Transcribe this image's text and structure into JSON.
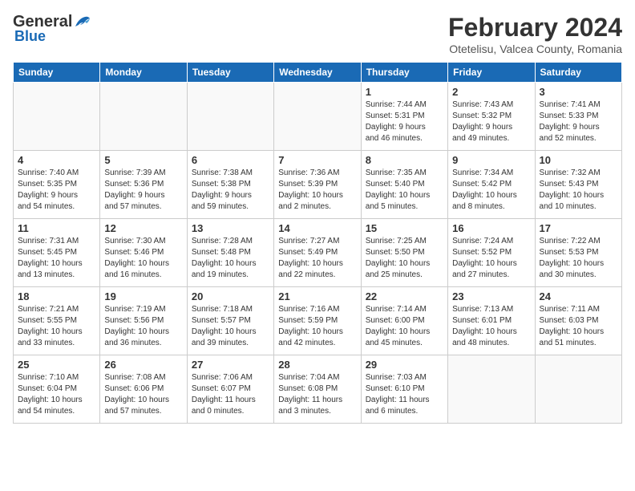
{
  "logo": {
    "general": "General",
    "blue": "Blue"
  },
  "title": {
    "month": "February 2024",
    "location": "Otetelisu, Valcea County, Romania"
  },
  "headers": [
    "Sunday",
    "Monday",
    "Tuesday",
    "Wednesday",
    "Thursday",
    "Friday",
    "Saturday"
  ],
  "weeks": [
    [
      {
        "day": "",
        "info": ""
      },
      {
        "day": "",
        "info": ""
      },
      {
        "day": "",
        "info": ""
      },
      {
        "day": "",
        "info": ""
      },
      {
        "day": "1",
        "info": "Sunrise: 7:44 AM\nSunset: 5:31 PM\nDaylight: 9 hours\nand 46 minutes."
      },
      {
        "day": "2",
        "info": "Sunrise: 7:43 AM\nSunset: 5:32 PM\nDaylight: 9 hours\nand 49 minutes."
      },
      {
        "day": "3",
        "info": "Sunrise: 7:41 AM\nSunset: 5:33 PM\nDaylight: 9 hours\nand 52 minutes."
      }
    ],
    [
      {
        "day": "4",
        "info": "Sunrise: 7:40 AM\nSunset: 5:35 PM\nDaylight: 9 hours\nand 54 minutes."
      },
      {
        "day": "5",
        "info": "Sunrise: 7:39 AM\nSunset: 5:36 PM\nDaylight: 9 hours\nand 57 minutes."
      },
      {
        "day": "6",
        "info": "Sunrise: 7:38 AM\nSunset: 5:38 PM\nDaylight: 9 hours\nand 59 minutes."
      },
      {
        "day": "7",
        "info": "Sunrise: 7:36 AM\nSunset: 5:39 PM\nDaylight: 10 hours\nand 2 minutes."
      },
      {
        "day": "8",
        "info": "Sunrise: 7:35 AM\nSunset: 5:40 PM\nDaylight: 10 hours\nand 5 minutes."
      },
      {
        "day": "9",
        "info": "Sunrise: 7:34 AM\nSunset: 5:42 PM\nDaylight: 10 hours\nand 8 minutes."
      },
      {
        "day": "10",
        "info": "Sunrise: 7:32 AM\nSunset: 5:43 PM\nDaylight: 10 hours\nand 10 minutes."
      }
    ],
    [
      {
        "day": "11",
        "info": "Sunrise: 7:31 AM\nSunset: 5:45 PM\nDaylight: 10 hours\nand 13 minutes."
      },
      {
        "day": "12",
        "info": "Sunrise: 7:30 AM\nSunset: 5:46 PM\nDaylight: 10 hours\nand 16 minutes."
      },
      {
        "day": "13",
        "info": "Sunrise: 7:28 AM\nSunset: 5:48 PM\nDaylight: 10 hours\nand 19 minutes."
      },
      {
        "day": "14",
        "info": "Sunrise: 7:27 AM\nSunset: 5:49 PM\nDaylight: 10 hours\nand 22 minutes."
      },
      {
        "day": "15",
        "info": "Sunrise: 7:25 AM\nSunset: 5:50 PM\nDaylight: 10 hours\nand 25 minutes."
      },
      {
        "day": "16",
        "info": "Sunrise: 7:24 AM\nSunset: 5:52 PM\nDaylight: 10 hours\nand 27 minutes."
      },
      {
        "day": "17",
        "info": "Sunrise: 7:22 AM\nSunset: 5:53 PM\nDaylight: 10 hours\nand 30 minutes."
      }
    ],
    [
      {
        "day": "18",
        "info": "Sunrise: 7:21 AM\nSunset: 5:55 PM\nDaylight: 10 hours\nand 33 minutes."
      },
      {
        "day": "19",
        "info": "Sunrise: 7:19 AM\nSunset: 5:56 PM\nDaylight: 10 hours\nand 36 minutes."
      },
      {
        "day": "20",
        "info": "Sunrise: 7:18 AM\nSunset: 5:57 PM\nDaylight: 10 hours\nand 39 minutes."
      },
      {
        "day": "21",
        "info": "Sunrise: 7:16 AM\nSunset: 5:59 PM\nDaylight: 10 hours\nand 42 minutes."
      },
      {
        "day": "22",
        "info": "Sunrise: 7:14 AM\nSunset: 6:00 PM\nDaylight: 10 hours\nand 45 minutes."
      },
      {
        "day": "23",
        "info": "Sunrise: 7:13 AM\nSunset: 6:01 PM\nDaylight: 10 hours\nand 48 minutes."
      },
      {
        "day": "24",
        "info": "Sunrise: 7:11 AM\nSunset: 6:03 PM\nDaylight: 10 hours\nand 51 minutes."
      }
    ],
    [
      {
        "day": "25",
        "info": "Sunrise: 7:10 AM\nSunset: 6:04 PM\nDaylight: 10 hours\nand 54 minutes."
      },
      {
        "day": "26",
        "info": "Sunrise: 7:08 AM\nSunset: 6:06 PM\nDaylight: 10 hours\nand 57 minutes."
      },
      {
        "day": "27",
        "info": "Sunrise: 7:06 AM\nSunset: 6:07 PM\nDaylight: 11 hours\nand 0 minutes."
      },
      {
        "day": "28",
        "info": "Sunrise: 7:04 AM\nSunset: 6:08 PM\nDaylight: 11 hours\nand 3 minutes."
      },
      {
        "day": "29",
        "info": "Sunrise: 7:03 AM\nSunset: 6:10 PM\nDaylight: 11 hours\nand 6 minutes."
      },
      {
        "day": "",
        "info": ""
      },
      {
        "day": "",
        "info": ""
      }
    ]
  ]
}
